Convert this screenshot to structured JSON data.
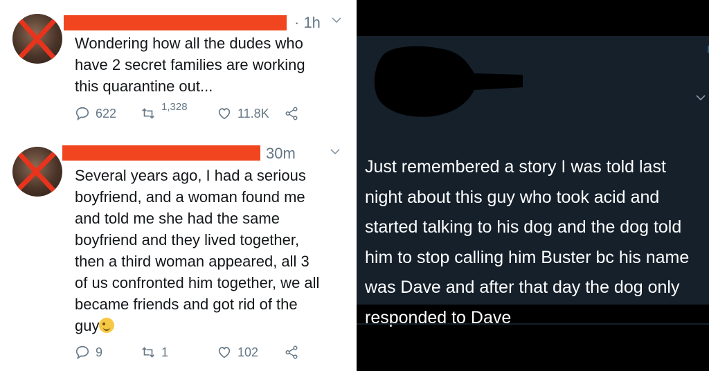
{
  "left_panel": {
    "tweets": [
      {
        "time": "· 1h",
        "text": "Wondering how all the dudes who\nhave 2 secret families are working\nthis quarantine out...",
        "replies": "622",
        "retweets": "1,328",
        "likes": "11.8K"
      },
      {
        "time": "30m",
        "text": "Several years ago, I had a serious\nboyfriend, and a woman found me\nand told me she had the same\nboyfriend and they lived together,\nthen a third woman appeared, all 3\nof us confronted him together, we all\nbecame friends and got rid of the\nguy",
        "emoji": "winking-face-emoji",
        "replies": "9",
        "retweets": "1",
        "likes": "102"
      }
    ],
    "colors": {
      "redaction": "#f1451f",
      "text": "#14171a",
      "muted": "#657786"
    }
  },
  "right_panel": {
    "text": "Just remembered a story I was told last night about this guy who took acid and started talking to his dog and the dog told him to stop calling him Buster bc his name was Dave and after that day the dog only responded to Dave",
    "colors": {
      "background": "#15202b",
      "text": "#ffffff"
    }
  },
  "icons": [
    "reply-icon",
    "retweet-icon",
    "like-icon",
    "share-icon",
    "chevron-down-icon"
  ]
}
